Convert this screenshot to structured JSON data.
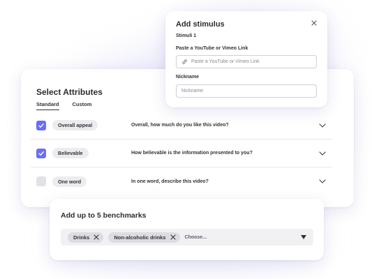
{
  "attributes": {
    "title": "Select Attributes",
    "tabs": [
      {
        "label": "Standard",
        "active": true
      },
      {
        "label": "Custom",
        "active": false
      }
    ],
    "rows": [
      {
        "checked": true,
        "attribute": "Overall appeal",
        "question": "Overall, how much do you like this video?"
      },
      {
        "checked": true,
        "attribute": "Believable",
        "question": "How believable is the information presented to you?"
      },
      {
        "checked": false,
        "attribute": "One word",
        "question": "In one word, describe this video?"
      }
    ]
  },
  "stimulus": {
    "title": "Add stimulus",
    "subtitle": "Stimuli 1",
    "link_label": "Paste a YouTube or Vimeo Link",
    "link_placeholder": "Paste a YouTube or Vimeo Link",
    "nickname_label": "Nickname",
    "nickname_placeholder": "Nickname"
  },
  "benchmarks": {
    "title": "Add up to 5 benchmarks",
    "chips": [
      "Drinks",
      "Non-alcoholic drinks"
    ],
    "placeholder": "Choose..."
  },
  "colors": {
    "accent": "#6b6ef6",
    "checkbox_off": "#e1e1e6",
    "pill_bg": "#ececf0",
    "select_bg": "#f1f1f4"
  },
  "icons": [
    "check-icon",
    "chevron-down-icon",
    "close-icon",
    "link-icon",
    "remove-chip-icon",
    "caret-down-icon"
  ]
}
